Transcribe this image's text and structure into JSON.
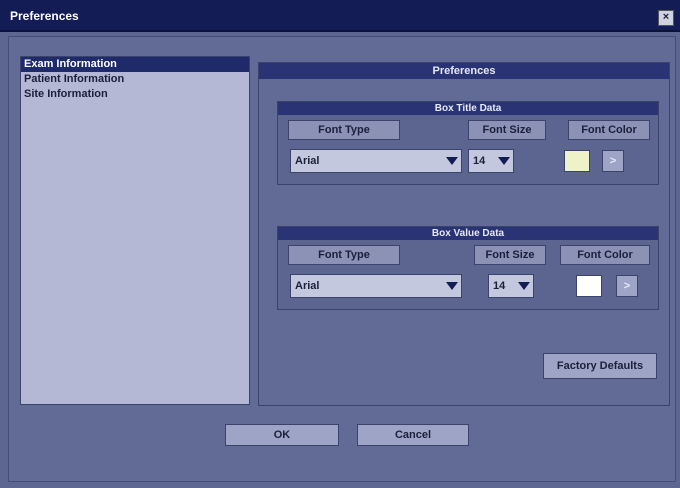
{
  "window": {
    "title": "Preferences"
  },
  "sidebar": {
    "items": [
      {
        "label": "Exam Information",
        "selected": true
      },
      {
        "label": "Patient Information",
        "selected": false
      },
      {
        "label": "Site Information",
        "selected": false
      }
    ]
  },
  "panel": {
    "title": "Preferences",
    "box_title": {
      "header": "Box Title Data",
      "font_type_label": "Font Type",
      "font_size_label": "Font Size",
      "font_color_label": "Font Color",
      "font_type_value": "Arial",
      "font_size_value": "14",
      "font_color_value": "#eef2c8",
      "pick_label": ">"
    },
    "box_value": {
      "header": "Box Value Data",
      "font_type_label": "Font Type",
      "font_size_label": "Font Size",
      "font_color_label": "Font Color",
      "font_type_value": "Arial",
      "font_size_value": "14",
      "font_color_value": "#ffffff",
      "pick_label": ">"
    },
    "factory_defaults_label": "Factory Defaults"
  },
  "buttons": {
    "ok": "OK",
    "cancel": "Cancel"
  },
  "icons": {
    "close": "close-icon",
    "dropdown": "chevron-down-icon"
  }
}
